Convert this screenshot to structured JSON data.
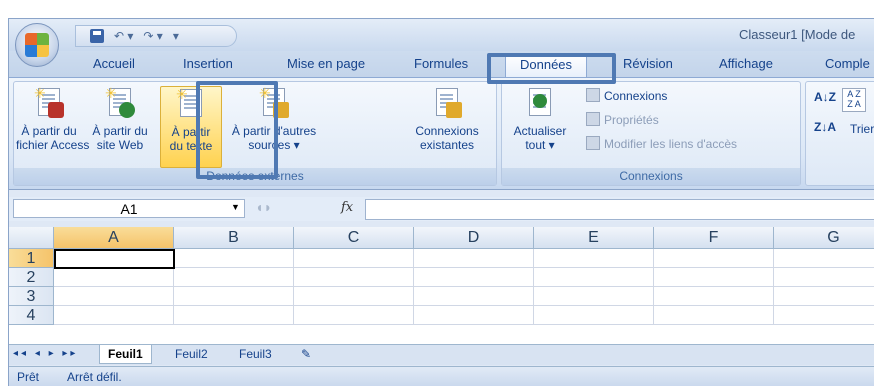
{
  "title_bar": {
    "app_title": "Classeur1 [Mode de",
    "qat_separator": "▾"
  },
  "tabs": [
    {
      "label": "Accueil",
      "active": false
    },
    {
      "label": "Insertion",
      "active": false
    },
    {
      "label": "Mise en page",
      "active": false
    },
    {
      "label": "Formules",
      "active": false
    },
    {
      "label": "Données",
      "active": true
    },
    {
      "label": "Révision",
      "active": false
    },
    {
      "label": "Affichage",
      "active": false
    },
    {
      "label": "Comple",
      "active": false
    }
  ],
  "ribbon": {
    "donnees_externes": {
      "label": "Données externes",
      "buttons": [
        {
          "line1": "À partir du",
          "line2": "fichier Access"
        },
        {
          "line1": "À partir du",
          "line2": "site Web"
        },
        {
          "line1": "À partir",
          "line2": "du texte"
        },
        {
          "line1": "À partir d'autres",
          "line2": "sources ▾"
        },
        {
          "line1": "Connexions",
          "line2": "existantes"
        }
      ]
    },
    "connexions": {
      "label": "Connexions",
      "refresh": {
        "line1": "Actualiser",
        "line2": "tout ▾"
      },
      "items": [
        "Connexions",
        "Propriétés",
        "Modifier les liens d'accès"
      ]
    },
    "sort": {
      "label": "Trier"
    }
  },
  "formula_bar": {
    "name_box": "A1",
    "fx": "fx",
    "value": ""
  },
  "grid": {
    "columns": [
      "A",
      "B",
      "C",
      "D",
      "E",
      "F",
      "G"
    ],
    "rows": [
      "1",
      "2",
      "3",
      "4"
    ],
    "active_cell": "A1"
  },
  "sheets": [
    {
      "label": "Feuil1",
      "active": true
    },
    {
      "label": "Feuil2",
      "active": false
    },
    {
      "label": "Feuil3",
      "active": false
    }
  ],
  "status": {
    "ready": "Prêt",
    "scroll": "Arrêt défil."
  },
  "colors": {
    "highlight_frame": "#4f79b3",
    "active_button": "#ffd24f",
    "header_selected": "#f5c36a"
  }
}
